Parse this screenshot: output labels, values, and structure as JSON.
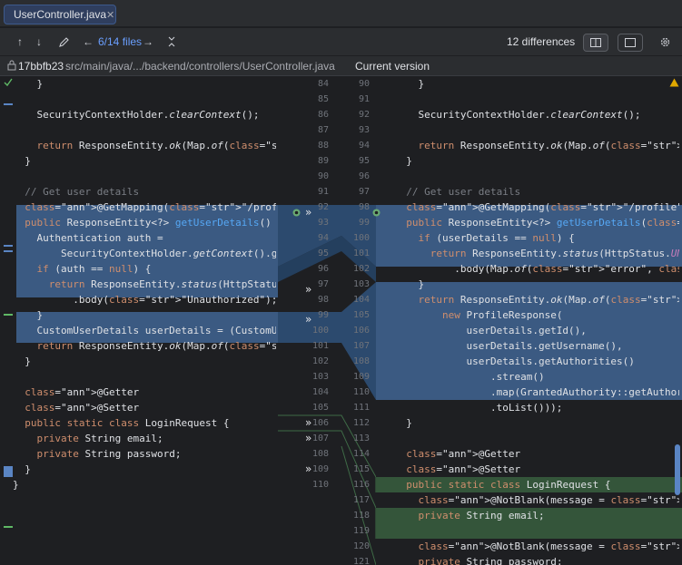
{
  "tab": {
    "filename": "UserController.java",
    "close": "✕"
  },
  "toolbar": {
    "prev_icon": "↑",
    "next_icon": "↓",
    "edit_icon": "pencil-icon",
    "back_icon": "←",
    "files_count": "6/14 files",
    "forward_icon": "→",
    "collapse_icon": "collapse-icon",
    "differences": "12 differences"
  },
  "path": {
    "hash": "17bbfb23",
    "file_path": "src/main/java/.../backend/controllers/UserController.java",
    "current_version": "Current version"
  },
  "left_lines": [
    {
      "t": "    }"
    },
    {
      "t": ""
    },
    {
      "t": "    SecurityContextHolder.clearContext();"
    },
    {
      "t": ""
    },
    {
      "t": "    return ResponseEntity.ok(Map.of(\"message\", \""
    },
    {
      "t": "  }"
    },
    {
      "t": ""
    },
    {
      "t": "  // Get user details"
    },
    {
      "t": "  @GetMapping(\"/profile\")"
    },
    {
      "t": "  public ResponseEntity<?> getUserDetails() {"
    },
    {
      "t": "    Authentication auth ="
    },
    {
      "t": "        SecurityContextHolder.getContext().getAu"
    },
    {
      "t": "    if (auth == null) {"
    },
    {
      "t": "      return ResponseEntity.status(HttpStatus.UN"
    },
    {
      "t": "          .body(\"Unauthorized\");"
    },
    {
      "t": "    }"
    },
    {
      "t": "    CustomUserDetails userDetails = (CustomUserD"
    },
    {
      "t": "    return ResponseEntity.ok(Map.of(\"user\", user"
    },
    {
      "t": "  }"
    },
    {
      "t": ""
    },
    {
      "t": "  @Getter"
    },
    {
      "t": "  @Setter"
    },
    {
      "t": "  public static class LoginRequest {"
    },
    {
      "t": "    private String email;"
    },
    {
      "t": "    private String password;"
    },
    {
      "t": "  }"
    },
    {
      "t": "}"
    }
  ],
  "left_nums": [
    "",
    "84",
    "85",
    "86",
    "87",
    "88",
    "89",
    "90",
    "91",
    "92",
    "93",
    "94",
    "95",
    "96",
    "97",
    "98",
    "99",
    "100",
    "101",
    "102",
    "103",
    "104",
    "105",
    "106",
    "107",
    "108",
    "109",
    "110"
  ],
  "right_nums": [
    "",
    "90",
    "91",
    "92",
    "93",
    "94",
    "95",
    "96",
    "97",
    "98",
    "99",
    "100",
    "101",
    "102",
    "103",
    "104",
    "105",
    "106",
    "107",
    "108",
    "109",
    "110",
    "111",
    "112",
    "113",
    "114",
    "115",
    "116",
    "117",
    "118",
    "119",
    "120",
    "121"
  ],
  "right_lines": [
    {
      "t": "    }"
    },
    {
      "t": ""
    },
    {
      "t": "    SecurityContextHolder.clearContext();"
    },
    {
      "t": ""
    },
    {
      "t": "    return ResponseEntity.ok(Map.of(\"message\", \"Logou"
    },
    {
      "t": "  }"
    },
    {
      "t": ""
    },
    {
      "t": "  // Get user details"
    },
    {
      "t": "  @GetMapping(\"/profile\")"
    },
    {
      "t": "  public ResponseEntity<?> getUserDetails(@Authentica"
    },
    {
      "t": "    if (userDetails == null) {"
    },
    {
      "t": "      return ResponseEntity.status(HttpStatus.UNAUTHO"
    },
    {
      "t": "          .body(Map.of(\"error\", \"Unauthorized\"));"
    },
    {
      "t": "    }"
    },
    {
      "t": "    return ResponseEntity.ok(Map.of(\"user\","
    },
    {
      "t": "        new ProfileResponse("
    },
    {
      "t": "            userDetails.getId(),"
    },
    {
      "t": "            userDetails.getUsername(),"
    },
    {
      "t": "            userDetails.getAuthorities()"
    },
    {
      "t": "                .stream()"
    },
    {
      "t": "                .map(GrantedAuthority::getAuthority)"
    },
    {
      "t": "                .toList()));"
    },
    {
      "t": "  }"
    },
    {
      "t": ""
    },
    {
      "t": "  @Getter"
    },
    {
      "t": "  @Setter"
    },
    {
      "t": "  public static class LoginRequest {"
    },
    {
      "t": "    @NotBlank(message = \"Email is required\")"
    },
    {
      "t": "    private String email;"
    },
    {
      "t": ""
    },
    {
      "t": "    @NotBlank(message = \"Password is required\")"
    },
    {
      "t": "    private String password;"
    },
    {
      "t": "  }"
    }
  ],
  "colors": {
    "background": "#1e1f22",
    "modified": "#3b5a82",
    "added": "#34553a",
    "accent": "#6a9fff"
  }
}
